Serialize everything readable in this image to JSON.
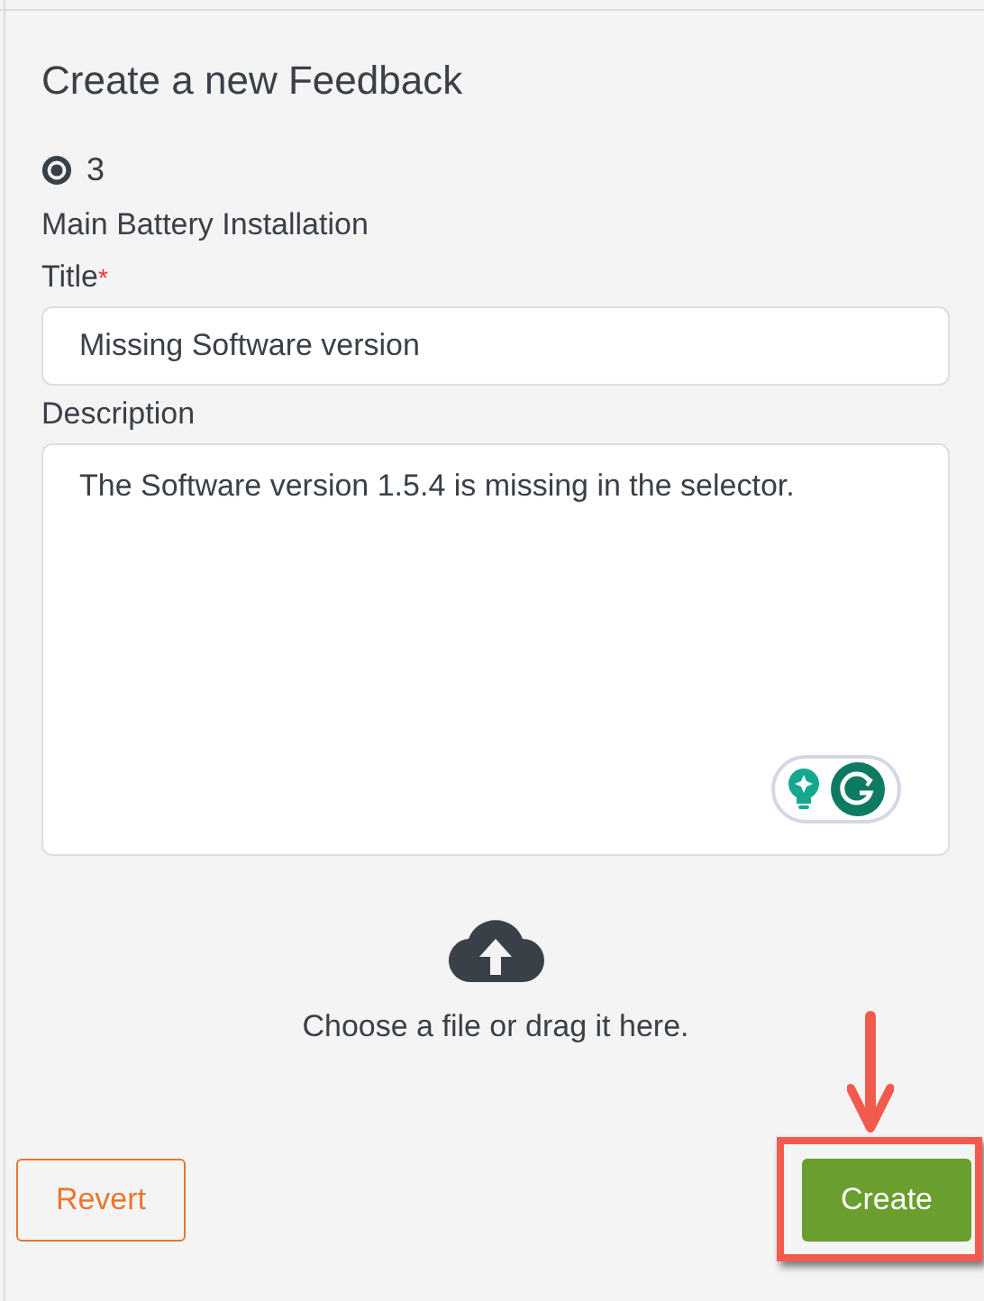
{
  "heading": "Create a new Feedback",
  "count": "3",
  "subtitle": "Main Battery Installation",
  "title_field": {
    "label": "Title",
    "required_mark": "*",
    "value": "Missing Software version"
  },
  "description_field": {
    "label": "Description",
    "value": "The Software version 1.5.4 is missing in the selector."
  },
  "upload": {
    "text": "Choose a file or drag it here."
  },
  "buttons": [
    {
      "label": "Revert",
      "kind": "outline"
    },
    {
      "label": "Create",
      "kind": "primary",
      "highlighted": true
    }
  ]
}
